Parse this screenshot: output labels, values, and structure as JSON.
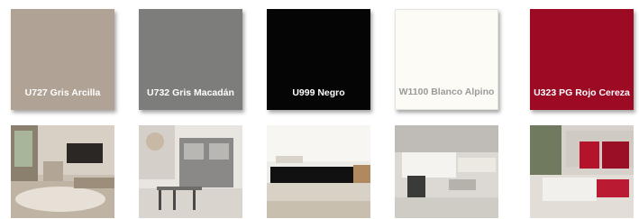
{
  "swatches": [
    {
      "code_name": "U727 Gris Arcilla",
      "color": "#b0a294",
      "text_color": "#ffffff"
    },
    {
      "code_name": "U732 Gris Macadán",
      "color": "#7d7d7b",
      "text_color": "#ffffff"
    },
    {
      "code_name": "U999 Negro",
      "color": "#050505",
      "text_color": "#ffffff"
    },
    {
      "code_name": "W1100 Blanco Alpino",
      "color": "#fcfbf6",
      "text_color": "#9a9a9a"
    },
    {
      "code_name": "U323 PG  Rojo Cereza",
      "color": "#9c0a24",
      "text_color": "#ffffff"
    }
  ]
}
